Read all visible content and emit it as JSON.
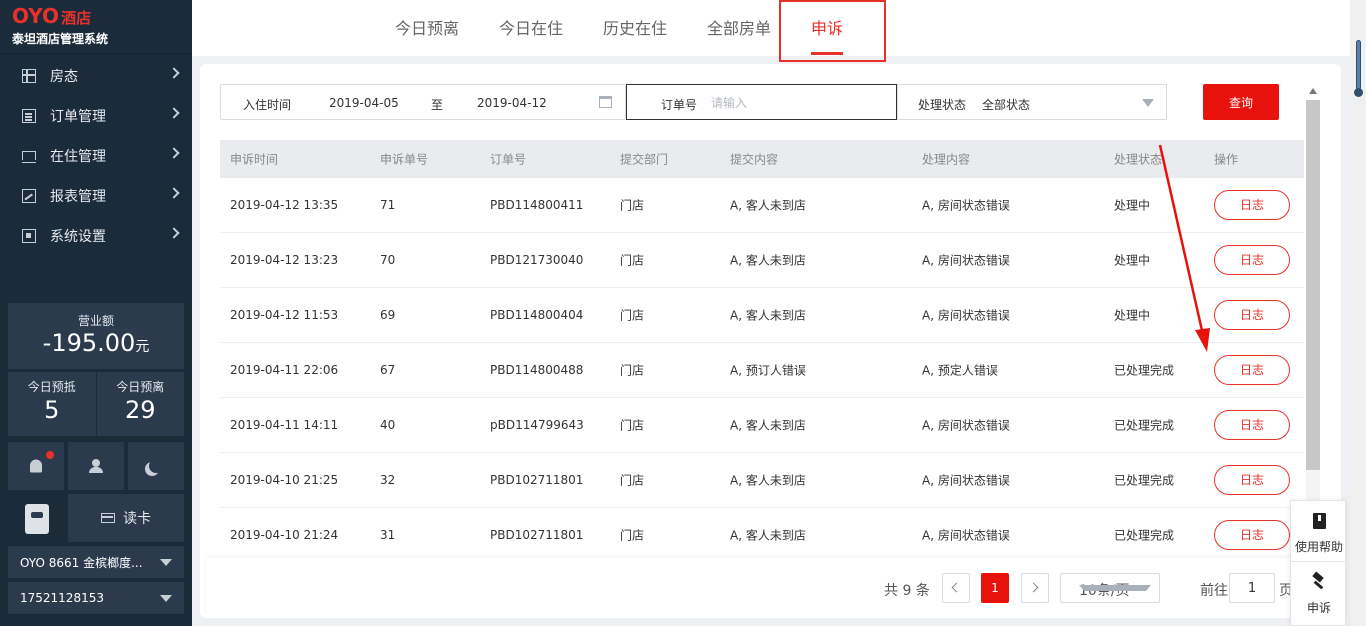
{
  "brand": {
    "logo": "OYO",
    "logo_suffix": "酒店",
    "subtitle": "泰坦酒店管理系统"
  },
  "sidebar": {
    "menu": [
      {
        "label": "房态",
        "icon": "grid-icon"
      },
      {
        "label": "订单管理",
        "icon": "document-icon"
      },
      {
        "label": "在住管理",
        "icon": "bed-icon"
      },
      {
        "label": "报表管理",
        "icon": "chart-icon"
      },
      {
        "label": "系统设置",
        "icon": "settings-icon"
      }
    ],
    "revenue_label": "营业额",
    "revenue_value": "-195.00",
    "revenue_unit": "元",
    "today_arrivals_label": "今日预抵",
    "today_arrivals_value": "5",
    "today_departures_label": "今日预离",
    "today_departures_value": "29",
    "read_card_label": "读卡",
    "hotel_select": "OYO 8661 金槟榔度...",
    "phone_select": "17521128153"
  },
  "tabs": [
    {
      "label": "今日预离"
    },
    {
      "label": "今日在住"
    },
    {
      "label": "历史在住"
    },
    {
      "label": "全部房单"
    },
    {
      "label": "申诉",
      "active": true
    }
  ],
  "filter": {
    "checkin_label": "入住时间",
    "date_from": "2019-04-05",
    "date_sep": "至",
    "date_to": "2019-04-12",
    "order_label": "订单号",
    "order_placeholder": "请输入",
    "status_label": "处理状态",
    "status_value": "全部状态",
    "query_button": "查询"
  },
  "table": {
    "headers": [
      "申诉时间",
      "申诉单号",
      "订单号",
      "提交部门",
      "提交内容",
      "处理内容",
      "处理状态",
      "操作"
    ],
    "action_label": "日志",
    "rows": [
      [
        "2019-04-12 13:35",
        "71",
        "PBD114800411",
        "门店",
        "A, 客人未到店",
        "A, 房间状态错误",
        "处理中"
      ],
      [
        "2019-04-12 13:23",
        "70",
        "PBD121730040",
        "门店",
        "A, 客人未到店",
        "A, 房间状态错误",
        "处理中"
      ],
      [
        "2019-04-12 11:53",
        "69",
        "PBD114800404",
        "门店",
        "A, 客人未到店",
        "A, 房间状态错误",
        "处理中"
      ],
      [
        "2019-04-11 22:06",
        "67",
        "PBD114800488",
        "门店",
        "A, 预订人错误",
        "A, 预定人错误",
        "已处理完成"
      ],
      [
        "2019-04-11 14:11",
        "40",
        "pBD114799643",
        "门店",
        "A, 客人未到店",
        "A, 房间状态错误",
        "已处理完成"
      ],
      [
        "2019-04-10 21:25",
        "32",
        "PBD102711801",
        "门店",
        "A, 客人未到店",
        "A, 房间状态错误",
        "已处理完成"
      ],
      [
        "2019-04-10 21:24",
        "31",
        "PBD102711801",
        "门店",
        "A, 客人未到店",
        "A, 房间状态错误",
        "已处理完成"
      ]
    ]
  },
  "pagination": {
    "total": "共 9 条",
    "current_page": "1",
    "page_size": "10条/页",
    "goto_label": "前往",
    "goto_value": "1",
    "page_suffix": "页"
  },
  "float_panel": {
    "help_label": "使用帮助",
    "appeal_label": "申诉"
  },
  "colors": {
    "accent": "#e8312a",
    "sidebar_bg": "#1c2b3a",
    "panel_bg": "#2b3b4d"
  }
}
